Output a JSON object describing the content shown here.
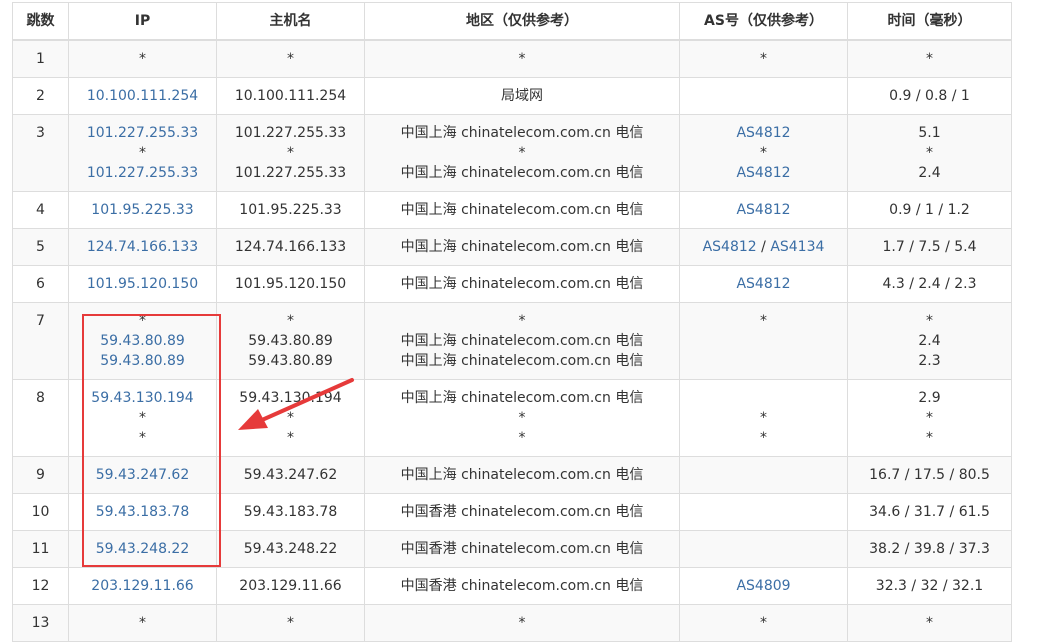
{
  "headers": [
    "跳数",
    "IP",
    "主机名",
    "地区（仅供参考）",
    "AS号（仅供参考）",
    "时间（毫秒）"
  ],
  "separator": " / ",
  "rows": [
    {
      "hop": "1",
      "ip": [
        "*"
      ],
      "host": [
        "*"
      ],
      "region": [
        "*"
      ],
      "as": [
        "*"
      ],
      "time": [
        "*"
      ]
    },
    {
      "hop": "2",
      "ip": [
        "10.100.111.254"
      ],
      "host": [
        "10.100.111.254"
      ],
      "region": [
        "局域网"
      ],
      "as": [
        ""
      ],
      "time": [
        "0.9 / 0.8 / 1"
      ]
    },
    {
      "hop": "3",
      "ip": [
        "101.227.255.33",
        "*",
        "101.227.255.33"
      ],
      "host": [
        "101.227.255.33",
        "*",
        "101.227.255.33"
      ],
      "region": [
        "中国上海 chinatelecom.com.cn 电信",
        "*",
        "中国上海 chinatelecom.com.cn 电信"
      ],
      "as": [
        "AS4812",
        "*",
        "AS4812"
      ],
      "time": [
        "5.1",
        "*",
        "2.4"
      ]
    },
    {
      "hop": "4",
      "ip": [
        "101.95.225.33"
      ],
      "host": [
        "101.95.225.33"
      ],
      "region": [
        "中国上海 chinatelecom.com.cn 电信"
      ],
      "as": [
        "AS4812"
      ],
      "time": [
        "0.9 / 1 / 1.2"
      ]
    },
    {
      "hop": "5",
      "ip": [
        "124.74.166.133"
      ],
      "host": [
        "124.74.166.133"
      ],
      "region": [
        "中国上海 chinatelecom.com.cn 电信"
      ],
      "as": [
        "AS4812 / AS4134"
      ],
      "time": [
        "1.7 / 7.5 / 5.4"
      ]
    },
    {
      "hop": "6",
      "ip": [
        "101.95.120.150"
      ],
      "host": [
        "101.95.120.150"
      ],
      "region": [
        "中国上海 chinatelecom.com.cn 电信"
      ],
      "as": [
        "AS4812"
      ],
      "time": [
        "4.3 / 2.4 / 2.3"
      ]
    },
    {
      "hop": "7",
      "ip": [
        "*",
        "59.43.80.89",
        "59.43.80.89"
      ],
      "host": [
        "*",
        "59.43.80.89",
        "59.43.80.89"
      ],
      "region": [
        "*",
        "中国上海 chinatelecom.com.cn 电信",
        "中国上海 chinatelecom.com.cn 电信"
      ],
      "as": [
        "*",
        "",
        ""
      ],
      "time": [
        "*",
        "2.4",
        "2.3"
      ]
    },
    {
      "hop": "8",
      "ip": [
        "59.43.130.194",
        "*",
        "*"
      ],
      "host": [
        "59.43.130.194",
        "*",
        "*"
      ],
      "region": [
        "中国上海 chinatelecom.com.cn 电信",
        "*",
        "*"
      ],
      "as": [
        "",
        "*",
        "*"
      ],
      "time": [
        "2.9",
        "*",
        "*"
      ]
    },
    {
      "hop": "9",
      "ip": [
        "59.43.247.62"
      ],
      "host": [
        "59.43.247.62"
      ],
      "region": [
        "中国上海 chinatelecom.com.cn 电信"
      ],
      "as": [
        ""
      ],
      "time": [
        "16.7 / 17.5 / 80.5"
      ]
    },
    {
      "hop": "10",
      "ip": [
        "59.43.183.78"
      ],
      "host": [
        "59.43.183.78"
      ],
      "region": [
        "中国香港 chinatelecom.com.cn 电信"
      ],
      "as": [
        ""
      ],
      "time": [
        "34.6 / 31.7 / 61.5"
      ]
    },
    {
      "hop": "11",
      "ip": [
        "59.43.248.22"
      ],
      "host": [
        "59.43.248.22"
      ],
      "region": [
        "中国香港 chinatelecom.com.cn 电信"
      ],
      "as": [
        ""
      ],
      "time": [
        "38.2 / 39.8 / 37.3"
      ]
    },
    {
      "hop": "12",
      "ip": [
        "203.129.11.66"
      ],
      "host": [
        "203.129.11.66"
      ],
      "region": [
        "中国香港 chinatelecom.com.cn 电信"
      ],
      "as": [
        "AS4809"
      ],
      "time": [
        "32.3 / 32 / 32.1"
      ]
    },
    {
      "hop": "13",
      "ip": [
        "*"
      ],
      "host": [
        "*"
      ],
      "region": [
        "*"
      ],
      "as": [
        "*"
      ],
      "time": [
        "*"
      ]
    }
  ],
  "colors": {
    "link": "#3b6ea5",
    "annotation": "#e63a3a",
    "row_alt": "#f9f9f9",
    "border": "#dddddd"
  }
}
